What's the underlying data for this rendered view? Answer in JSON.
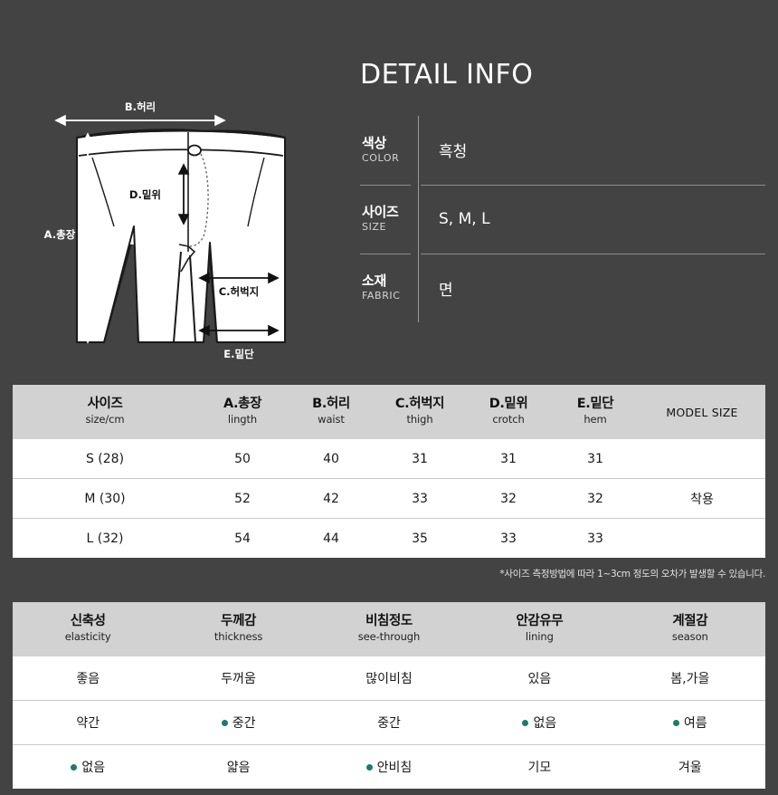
{
  "background_color": "#434343",
  "accent_dot_color": "#1c7a6b",
  "detail_info": {
    "title": "DETAIL INFO",
    "rows": [
      {
        "label_ko": "색상",
        "label_en": "COLOR",
        "value": "흑청"
      },
      {
        "label_ko": "사이즈",
        "label_en": "SIZE",
        "value": "S, M, L"
      },
      {
        "label_ko": "소재",
        "label_en": "FABRIC",
        "value": "면"
      }
    ]
  },
  "diagram": {
    "measurements": [
      {
        "code": "A",
        "label": "A.총장"
      },
      {
        "code": "B",
        "label": "B.허리"
      },
      {
        "code": "C",
        "label": "C.허벅지"
      },
      {
        "code": "D",
        "label": "D.밑위"
      },
      {
        "code": "E",
        "label": "E.밑단"
      }
    ]
  },
  "size_table": {
    "headers": [
      {
        "ko": "사이즈",
        "en": "size/cm"
      },
      {
        "ko": "A.총장",
        "en": "lingth"
      },
      {
        "ko": "B.허리",
        "en": "waist"
      },
      {
        "ko": "C.허벅지",
        "en": "thigh"
      },
      {
        "ko": "D.밑위",
        "en": "crotch"
      },
      {
        "ko": "E.밑단",
        "en": "hem"
      },
      {
        "ko": "MODEL SIZE",
        "en": ""
      }
    ],
    "rows": [
      {
        "size": "S (28)",
        "length": "50",
        "waist": "40",
        "thigh": "31",
        "crotch": "31",
        "hem": "31",
        "model": ""
      },
      {
        "size": "M (30)",
        "length": "52",
        "waist": "42",
        "thigh": "33",
        "crotch": "32",
        "hem": "32",
        "model": "착용"
      },
      {
        "size": "L (32)",
        "length": "54",
        "waist": "44",
        "thigh": "35",
        "crotch": "33",
        "hem": "33",
        "model": ""
      }
    ],
    "note": "*사이즈 측정방법에 따라 1~3cm 정도의 오차가 발생할 수 있습니다."
  },
  "attribute_table": {
    "headers": [
      {
        "ko": "신축성",
        "en": "elasticity"
      },
      {
        "ko": "두께감",
        "en": "thickness"
      },
      {
        "ko": "비침정도",
        "en": "see-through"
      },
      {
        "ko": "안감유무",
        "en": "lining"
      },
      {
        "ko": "계절감",
        "en": "season"
      }
    ],
    "rows": [
      [
        {
          "text": "좋음",
          "selected": false
        },
        {
          "text": "두꺼움",
          "selected": false
        },
        {
          "text": "많이비침",
          "selected": false
        },
        {
          "text": "있음",
          "selected": false
        },
        {
          "text": "봄,가을",
          "selected": false
        }
      ],
      [
        {
          "text": "약간",
          "selected": false
        },
        {
          "text": "중간",
          "selected": true
        },
        {
          "text": "중간",
          "selected": false
        },
        {
          "text": "없음",
          "selected": true
        },
        {
          "text": "여름",
          "selected": true
        }
      ],
      [
        {
          "text": "없음",
          "selected": true
        },
        {
          "text": "얇음",
          "selected": false
        },
        {
          "text": "안비침",
          "selected": true
        },
        {
          "text": "기모",
          "selected": false
        },
        {
          "text": "겨울",
          "selected": false
        }
      ]
    ]
  }
}
